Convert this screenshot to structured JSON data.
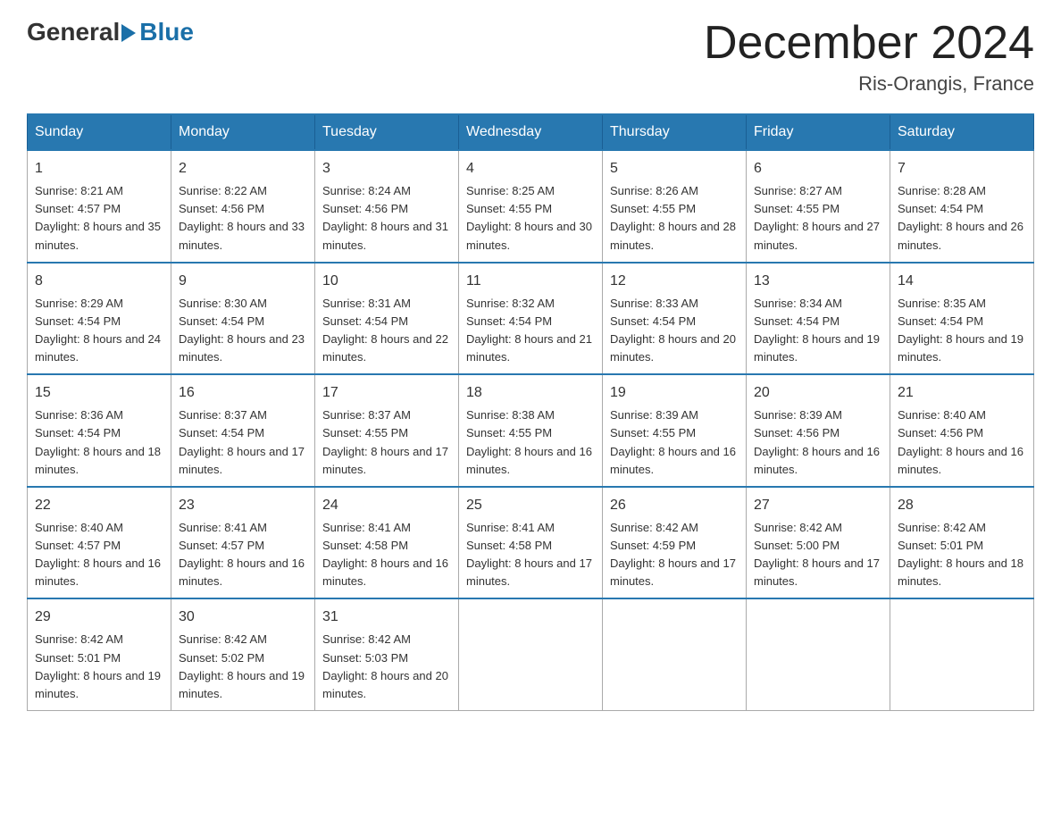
{
  "header": {
    "logo": {
      "general": "General",
      "blue": "Blue"
    },
    "title": "December 2024",
    "location": "Ris-Orangis, France"
  },
  "calendar": {
    "weekdays": [
      "Sunday",
      "Monday",
      "Tuesday",
      "Wednesday",
      "Thursday",
      "Friday",
      "Saturday"
    ],
    "weeks": [
      [
        {
          "day": "1",
          "sunrise": "8:21 AM",
          "sunset": "4:57 PM",
          "daylight": "8 hours and 35 minutes."
        },
        {
          "day": "2",
          "sunrise": "8:22 AM",
          "sunset": "4:56 PM",
          "daylight": "8 hours and 33 minutes."
        },
        {
          "day": "3",
          "sunrise": "8:24 AM",
          "sunset": "4:56 PM",
          "daylight": "8 hours and 31 minutes."
        },
        {
          "day": "4",
          "sunrise": "8:25 AM",
          "sunset": "4:55 PM",
          "daylight": "8 hours and 30 minutes."
        },
        {
          "day": "5",
          "sunrise": "8:26 AM",
          "sunset": "4:55 PM",
          "daylight": "8 hours and 28 minutes."
        },
        {
          "day": "6",
          "sunrise": "8:27 AM",
          "sunset": "4:55 PM",
          "daylight": "8 hours and 27 minutes."
        },
        {
          "day": "7",
          "sunrise": "8:28 AM",
          "sunset": "4:54 PM",
          "daylight": "8 hours and 26 minutes."
        }
      ],
      [
        {
          "day": "8",
          "sunrise": "8:29 AM",
          "sunset": "4:54 PM",
          "daylight": "8 hours and 24 minutes."
        },
        {
          "day": "9",
          "sunrise": "8:30 AM",
          "sunset": "4:54 PM",
          "daylight": "8 hours and 23 minutes."
        },
        {
          "day": "10",
          "sunrise": "8:31 AM",
          "sunset": "4:54 PM",
          "daylight": "8 hours and 22 minutes."
        },
        {
          "day": "11",
          "sunrise": "8:32 AM",
          "sunset": "4:54 PM",
          "daylight": "8 hours and 21 minutes."
        },
        {
          "day": "12",
          "sunrise": "8:33 AM",
          "sunset": "4:54 PM",
          "daylight": "8 hours and 20 minutes."
        },
        {
          "day": "13",
          "sunrise": "8:34 AM",
          "sunset": "4:54 PM",
          "daylight": "8 hours and 19 minutes."
        },
        {
          "day": "14",
          "sunrise": "8:35 AM",
          "sunset": "4:54 PM",
          "daylight": "8 hours and 19 minutes."
        }
      ],
      [
        {
          "day": "15",
          "sunrise": "8:36 AM",
          "sunset": "4:54 PM",
          "daylight": "8 hours and 18 minutes."
        },
        {
          "day": "16",
          "sunrise": "8:37 AM",
          "sunset": "4:54 PM",
          "daylight": "8 hours and 17 minutes."
        },
        {
          "day": "17",
          "sunrise": "8:37 AM",
          "sunset": "4:55 PM",
          "daylight": "8 hours and 17 minutes."
        },
        {
          "day": "18",
          "sunrise": "8:38 AM",
          "sunset": "4:55 PM",
          "daylight": "8 hours and 16 minutes."
        },
        {
          "day": "19",
          "sunrise": "8:39 AM",
          "sunset": "4:55 PM",
          "daylight": "8 hours and 16 minutes."
        },
        {
          "day": "20",
          "sunrise": "8:39 AM",
          "sunset": "4:56 PM",
          "daylight": "8 hours and 16 minutes."
        },
        {
          "day": "21",
          "sunrise": "8:40 AM",
          "sunset": "4:56 PM",
          "daylight": "8 hours and 16 minutes."
        }
      ],
      [
        {
          "day": "22",
          "sunrise": "8:40 AM",
          "sunset": "4:57 PM",
          "daylight": "8 hours and 16 minutes."
        },
        {
          "day": "23",
          "sunrise": "8:41 AM",
          "sunset": "4:57 PM",
          "daylight": "8 hours and 16 minutes."
        },
        {
          "day": "24",
          "sunrise": "8:41 AM",
          "sunset": "4:58 PM",
          "daylight": "8 hours and 16 minutes."
        },
        {
          "day": "25",
          "sunrise": "8:41 AM",
          "sunset": "4:58 PM",
          "daylight": "8 hours and 17 minutes."
        },
        {
          "day": "26",
          "sunrise": "8:42 AM",
          "sunset": "4:59 PM",
          "daylight": "8 hours and 17 minutes."
        },
        {
          "day": "27",
          "sunrise": "8:42 AM",
          "sunset": "5:00 PM",
          "daylight": "8 hours and 17 minutes."
        },
        {
          "day": "28",
          "sunrise": "8:42 AM",
          "sunset": "5:01 PM",
          "daylight": "8 hours and 18 minutes."
        }
      ],
      [
        {
          "day": "29",
          "sunrise": "8:42 AM",
          "sunset": "5:01 PM",
          "daylight": "8 hours and 19 minutes."
        },
        {
          "day": "30",
          "sunrise": "8:42 AM",
          "sunset": "5:02 PM",
          "daylight": "8 hours and 19 minutes."
        },
        {
          "day": "31",
          "sunrise": "8:42 AM",
          "sunset": "5:03 PM",
          "daylight": "8 hours and 20 minutes."
        },
        null,
        null,
        null,
        null
      ]
    ]
  }
}
